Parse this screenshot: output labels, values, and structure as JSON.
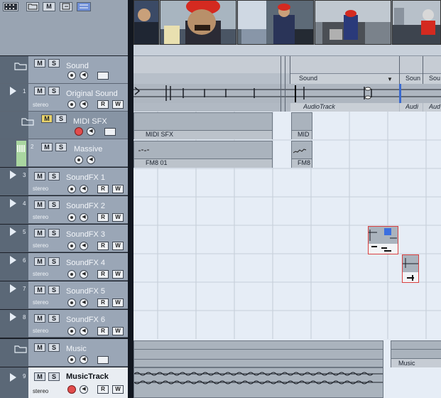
{
  "tracks": [
    {
      "number": "",
      "name": "Sound",
      "sub": "",
      "kind": "folder"
    },
    {
      "number": "1",
      "name": "Original Sound",
      "sub": "stereo",
      "kind": "audio"
    },
    {
      "number": "",
      "name": "MIDI SFX",
      "sub": "",
      "kind": "midifolder"
    },
    {
      "number": "2",
      "name": "Massive",
      "sub": "",
      "kind": "instrument"
    },
    {
      "number": "3",
      "name": "SoundFX 1",
      "sub": "stereo",
      "kind": "audio"
    },
    {
      "number": "4",
      "name": "SoundFX 2",
      "sub": "stereo",
      "kind": "audio"
    },
    {
      "number": "5",
      "name": "SoundFX 3",
      "sub": "stereo",
      "kind": "audio"
    },
    {
      "number": "6",
      "name": "SoundFX 4",
      "sub": "stereo",
      "kind": "audio"
    },
    {
      "number": "7",
      "name": "SoundFX 5",
      "sub": "stereo",
      "kind": "audio"
    },
    {
      "number": "8",
      "name": "SoundFX 6",
      "sub": "stereo",
      "kind": "audio"
    },
    {
      "number": "",
      "name": "Music",
      "sub": "",
      "kind": "folder"
    },
    {
      "number": "9",
      "name": "MusicTrack",
      "sub": "stereo",
      "kind": "audio-rec"
    }
  ],
  "buttons": {
    "mute": "M",
    "solo": "S",
    "read": "R",
    "write": "W",
    "toolbar_m": "M"
  },
  "events": {
    "sound_part": "Sound",
    "sound_part_short": "Soun",
    "sound_part_short2": "Sou",
    "audio_track": "AudioTrack",
    "audio_track_short": "Audi",
    "audio_track_short2": "Aud",
    "midi_part": "MIDI SFX",
    "midi_part_short": "MID",
    "fm8": "FM8 01",
    "fm8_short": "FM8",
    "music_part": "Music"
  },
  "colors": {
    "panel": "#9aa6b6",
    "arrange": "#e2e9f2",
    "event": "#aab3bd",
    "mute_active": "#e9d36a",
    "record": "#e24c4c"
  }
}
